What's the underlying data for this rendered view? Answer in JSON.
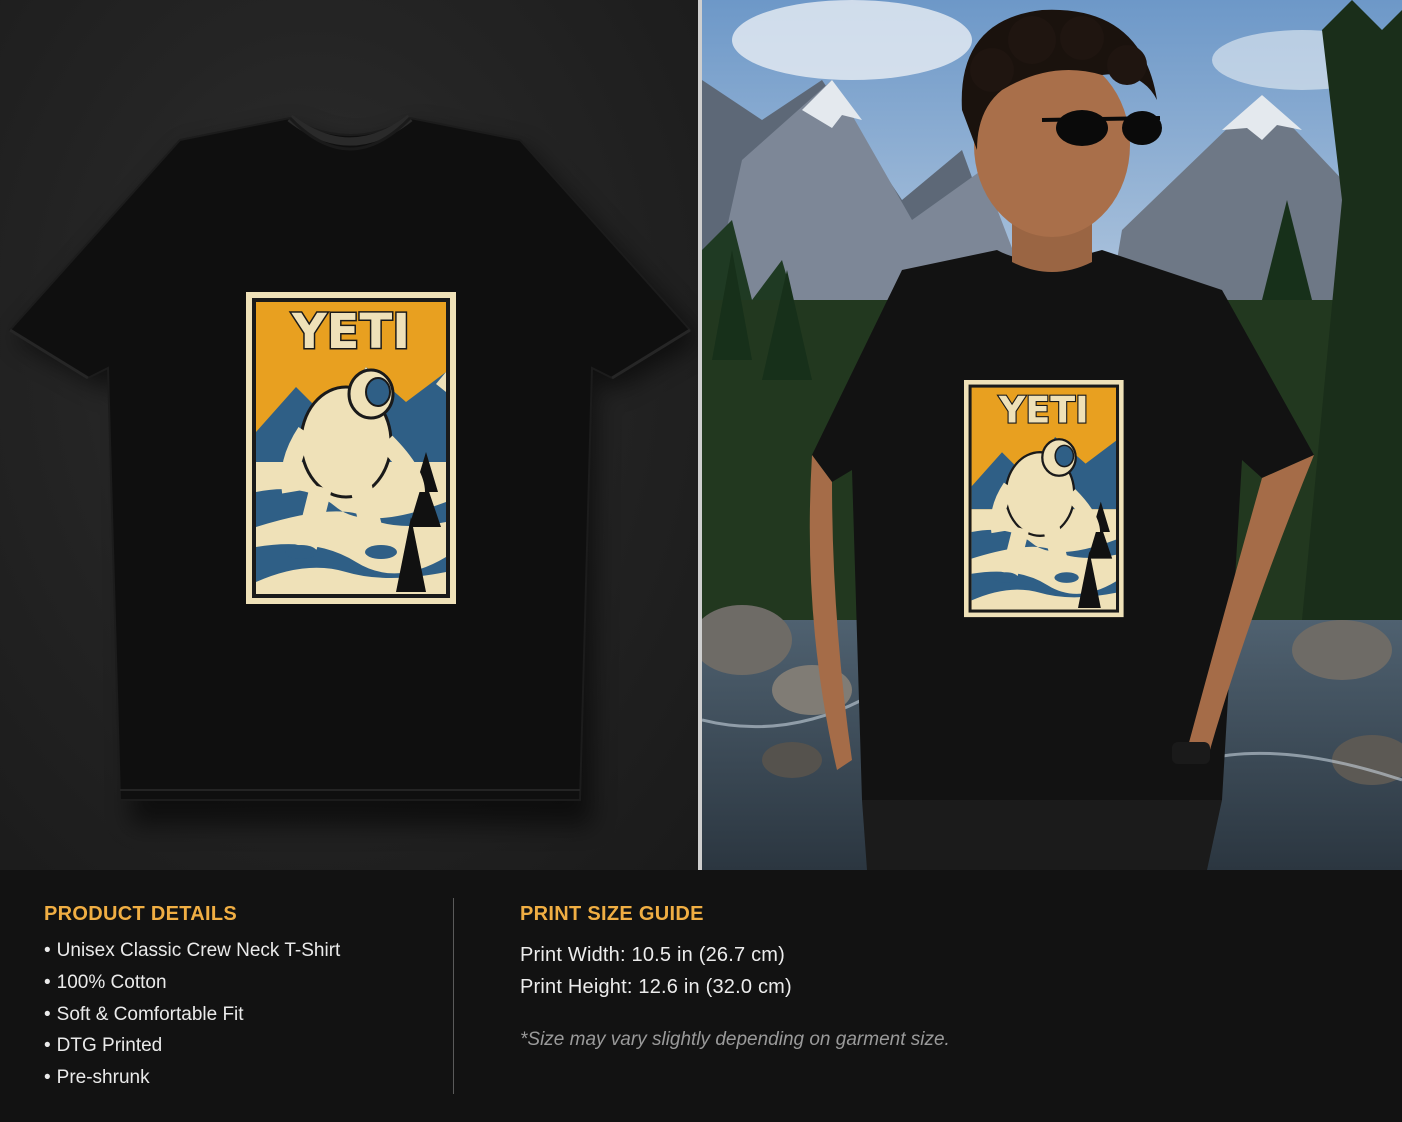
{
  "colors": {
    "accent": "#f0ae43",
    "background": "#121212",
    "shirt": "#0e0e0e",
    "print_orange": "#e8a020",
    "print_cream": "#efe1b8",
    "print_blue": "#2f5f86"
  },
  "mockup_flat": {
    "print_title": "YETI"
  },
  "mockup_model": {
    "print_title": "YETI"
  },
  "product_details": {
    "heading": "PRODUCT DETAILS",
    "items": [
      "Unisex Classic Crew Neck T-Shirt",
      "100% Cotton",
      "Soft & Comfortable Fit",
      "DTG Printed",
      "Pre-shrunk"
    ]
  },
  "print_size_guide": {
    "heading": "PRINT SIZE GUIDE",
    "width_line": "Print Width: 10.5 in (26.7 cm)",
    "height_line": "Print Height: 12.6 in (32.0 cm)",
    "note": "*Size may vary slightly depending on garment size."
  }
}
